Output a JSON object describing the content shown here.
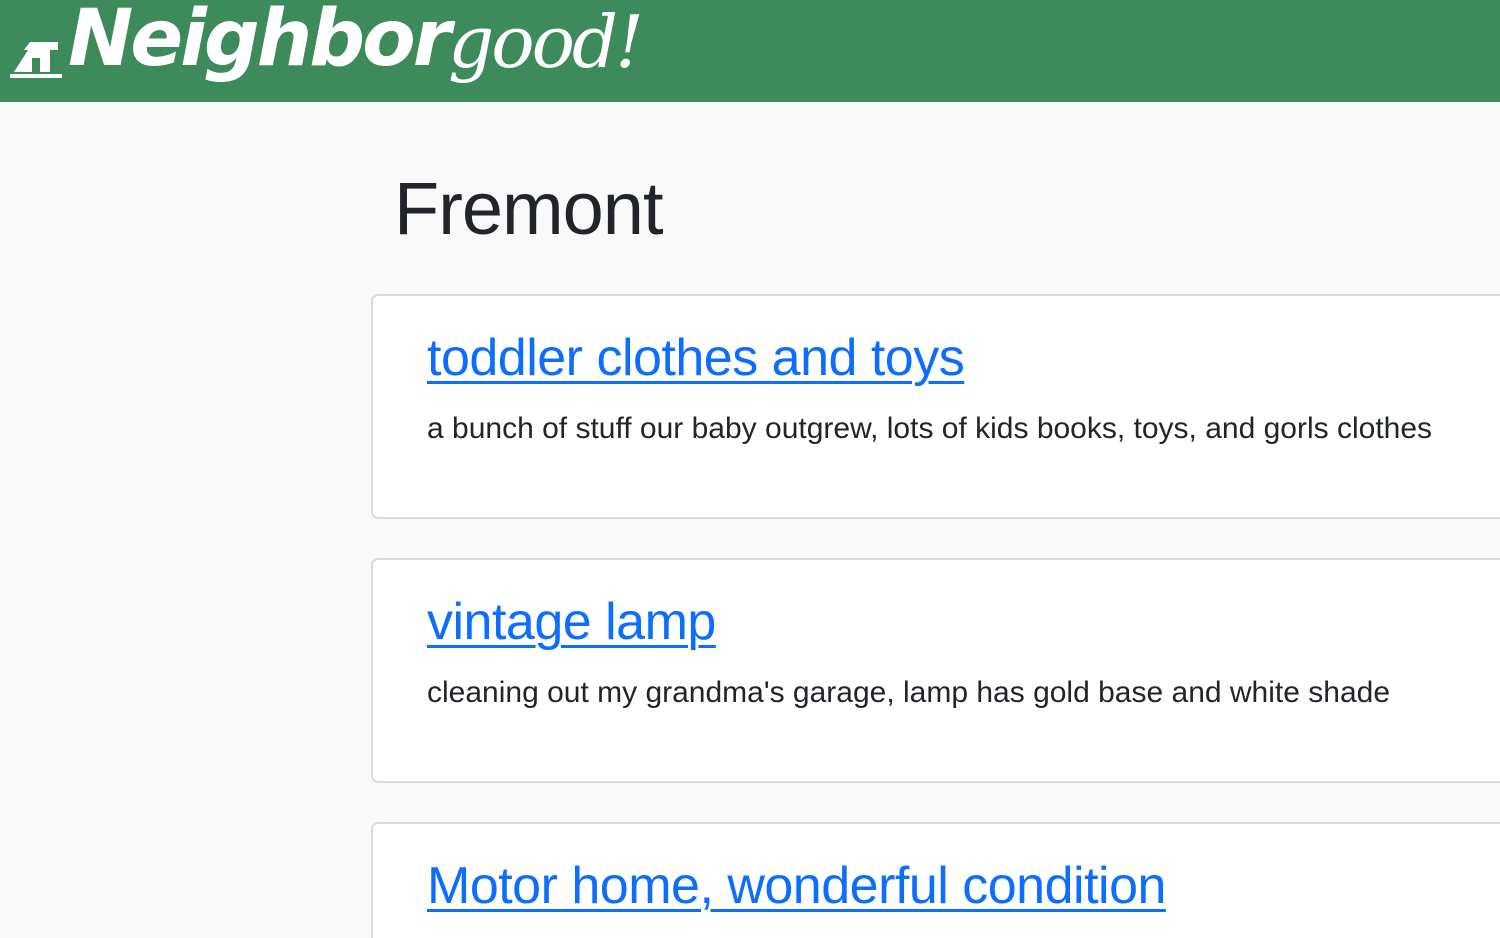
{
  "header": {
    "logo_bold": "Neighbor",
    "logo_light": "good!",
    "bg_color": "#3d8a5b"
  },
  "page": {
    "title": "Fremont"
  },
  "listings": [
    {
      "title": "toddler clothes and toys",
      "description": "a bunch of stuff our baby outgrew, lots of kids books, toys, and gorls clothes"
    },
    {
      "title": "vintage lamp",
      "description": "cleaning out my grandma's garage, lamp has gold base and white shade"
    },
    {
      "title": "Motor home, wonderful condition"
    }
  ],
  "colors": {
    "link": "#0d6efd",
    "text": "#212529",
    "page_bg": "#f9f9f9",
    "card_border": "#dcdcdc"
  }
}
